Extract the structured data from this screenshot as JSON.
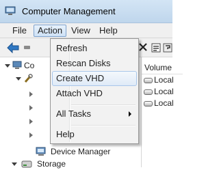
{
  "window": {
    "title": "Computer Management"
  },
  "menubar": {
    "items": [
      {
        "label": "File"
      },
      {
        "label": "Action",
        "active": true
      },
      {
        "label": "View"
      },
      {
        "label": "Help"
      }
    ]
  },
  "action_menu": {
    "items": [
      {
        "label": "Refresh"
      },
      {
        "label": "Rescan Disks"
      },
      {
        "label": "Create VHD",
        "highlighted": true
      },
      {
        "label": "Attach VHD"
      },
      {
        "label": "All Tasks",
        "has_submenu": true
      },
      {
        "label": "Help"
      }
    ]
  },
  "tree": {
    "root_label": "Co",
    "device_manager": "Device Manager",
    "storage": "Storage"
  },
  "volume_list": {
    "header": "Volume",
    "rows": [
      "Local",
      "Local",
      "Local"
    ]
  },
  "icons": {
    "app": "computer-management-icon",
    "back": "back-arrow-icon",
    "close": "close-icon",
    "properties": "properties-icon"
  },
  "colors": {
    "titlebar": "#c9ddf1",
    "menu_highlight_border": "#7da2ce",
    "back_arrow": "#2f78c4"
  }
}
